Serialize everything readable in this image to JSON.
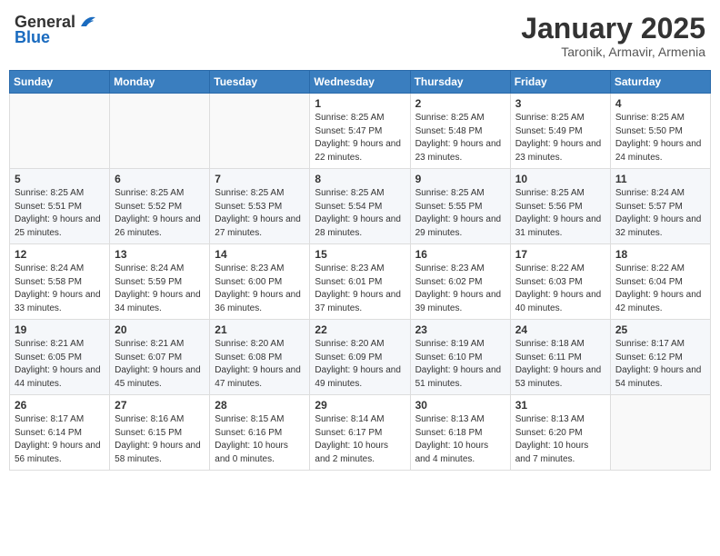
{
  "header": {
    "logo_line1": "General",
    "logo_line2": "Blue",
    "month_title": "January 2025",
    "location": "Taronik, Armavir, Armenia"
  },
  "days_of_week": [
    "Sunday",
    "Monday",
    "Tuesday",
    "Wednesday",
    "Thursday",
    "Friday",
    "Saturday"
  ],
  "weeks": [
    [
      {
        "day": "",
        "sunrise": "",
        "sunset": "",
        "daylight": ""
      },
      {
        "day": "",
        "sunrise": "",
        "sunset": "",
        "daylight": ""
      },
      {
        "day": "",
        "sunrise": "",
        "sunset": "",
        "daylight": ""
      },
      {
        "day": "1",
        "sunrise": "Sunrise: 8:25 AM",
        "sunset": "Sunset: 5:47 PM",
        "daylight": "Daylight: 9 hours and 22 minutes."
      },
      {
        "day": "2",
        "sunrise": "Sunrise: 8:25 AM",
        "sunset": "Sunset: 5:48 PM",
        "daylight": "Daylight: 9 hours and 23 minutes."
      },
      {
        "day": "3",
        "sunrise": "Sunrise: 8:25 AM",
        "sunset": "Sunset: 5:49 PM",
        "daylight": "Daylight: 9 hours and 23 minutes."
      },
      {
        "day": "4",
        "sunrise": "Sunrise: 8:25 AM",
        "sunset": "Sunset: 5:50 PM",
        "daylight": "Daylight: 9 hours and 24 minutes."
      }
    ],
    [
      {
        "day": "5",
        "sunrise": "Sunrise: 8:25 AM",
        "sunset": "Sunset: 5:51 PM",
        "daylight": "Daylight: 9 hours and 25 minutes."
      },
      {
        "day": "6",
        "sunrise": "Sunrise: 8:25 AM",
        "sunset": "Sunset: 5:52 PM",
        "daylight": "Daylight: 9 hours and 26 minutes."
      },
      {
        "day": "7",
        "sunrise": "Sunrise: 8:25 AM",
        "sunset": "Sunset: 5:53 PM",
        "daylight": "Daylight: 9 hours and 27 minutes."
      },
      {
        "day": "8",
        "sunrise": "Sunrise: 8:25 AM",
        "sunset": "Sunset: 5:54 PM",
        "daylight": "Daylight: 9 hours and 28 minutes."
      },
      {
        "day": "9",
        "sunrise": "Sunrise: 8:25 AM",
        "sunset": "Sunset: 5:55 PM",
        "daylight": "Daylight: 9 hours and 29 minutes."
      },
      {
        "day": "10",
        "sunrise": "Sunrise: 8:25 AM",
        "sunset": "Sunset: 5:56 PM",
        "daylight": "Daylight: 9 hours and 31 minutes."
      },
      {
        "day": "11",
        "sunrise": "Sunrise: 8:24 AM",
        "sunset": "Sunset: 5:57 PM",
        "daylight": "Daylight: 9 hours and 32 minutes."
      }
    ],
    [
      {
        "day": "12",
        "sunrise": "Sunrise: 8:24 AM",
        "sunset": "Sunset: 5:58 PM",
        "daylight": "Daylight: 9 hours and 33 minutes."
      },
      {
        "day": "13",
        "sunrise": "Sunrise: 8:24 AM",
        "sunset": "Sunset: 5:59 PM",
        "daylight": "Daylight: 9 hours and 34 minutes."
      },
      {
        "day": "14",
        "sunrise": "Sunrise: 8:23 AM",
        "sunset": "Sunset: 6:00 PM",
        "daylight": "Daylight: 9 hours and 36 minutes."
      },
      {
        "day": "15",
        "sunrise": "Sunrise: 8:23 AM",
        "sunset": "Sunset: 6:01 PM",
        "daylight": "Daylight: 9 hours and 37 minutes."
      },
      {
        "day": "16",
        "sunrise": "Sunrise: 8:23 AM",
        "sunset": "Sunset: 6:02 PM",
        "daylight": "Daylight: 9 hours and 39 minutes."
      },
      {
        "day": "17",
        "sunrise": "Sunrise: 8:22 AM",
        "sunset": "Sunset: 6:03 PM",
        "daylight": "Daylight: 9 hours and 40 minutes."
      },
      {
        "day": "18",
        "sunrise": "Sunrise: 8:22 AM",
        "sunset": "Sunset: 6:04 PM",
        "daylight": "Daylight: 9 hours and 42 minutes."
      }
    ],
    [
      {
        "day": "19",
        "sunrise": "Sunrise: 8:21 AM",
        "sunset": "Sunset: 6:05 PM",
        "daylight": "Daylight: 9 hours and 44 minutes."
      },
      {
        "day": "20",
        "sunrise": "Sunrise: 8:21 AM",
        "sunset": "Sunset: 6:07 PM",
        "daylight": "Daylight: 9 hours and 45 minutes."
      },
      {
        "day": "21",
        "sunrise": "Sunrise: 8:20 AM",
        "sunset": "Sunset: 6:08 PM",
        "daylight": "Daylight: 9 hours and 47 minutes."
      },
      {
        "day": "22",
        "sunrise": "Sunrise: 8:20 AM",
        "sunset": "Sunset: 6:09 PM",
        "daylight": "Daylight: 9 hours and 49 minutes."
      },
      {
        "day": "23",
        "sunrise": "Sunrise: 8:19 AM",
        "sunset": "Sunset: 6:10 PM",
        "daylight": "Daylight: 9 hours and 51 minutes."
      },
      {
        "day": "24",
        "sunrise": "Sunrise: 8:18 AM",
        "sunset": "Sunset: 6:11 PM",
        "daylight": "Daylight: 9 hours and 53 minutes."
      },
      {
        "day": "25",
        "sunrise": "Sunrise: 8:17 AM",
        "sunset": "Sunset: 6:12 PM",
        "daylight": "Daylight: 9 hours and 54 minutes."
      }
    ],
    [
      {
        "day": "26",
        "sunrise": "Sunrise: 8:17 AM",
        "sunset": "Sunset: 6:14 PM",
        "daylight": "Daylight: 9 hours and 56 minutes."
      },
      {
        "day": "27",
        "sunrise": "Sunrise: 8:16 AM",
        "sunset": "Sunset: 6:15 PM",
        "daylight": "Daylight: 9 hours and 58 minutes."
      },
      {
        "day": "28",
        "sunrise": "Sunrise: 8:15 AM",
        "sunset": "Sunset: 6:16 PM",
        "daylight": "Daylight: 10 hours and 0 minutes."
      },
      {
        "day": "29",
        "sunrise": "Sunrise: 8:14 AM",
        "sunset": "Sunset: 6:17 PM",
        "daylight": "Daylight: 10 hours and 2 minutes."
      },
      {
        "day": "30",
        "sunrise": "Sunrise: 8:13 AM",
        "sunset": "Sunset: 6:18 PM",
        "daylight": "Daylight: 10 hours and 4 minutes."
      },
      {
        "day": "31",
        "sunrise": "Sunrise: 8:13 AM",
        "sunset": "Sunset: 6:20 PM",
        "daylight": "Daylight: 10 hours and 7 minutes."
      },
      {
        "day": "",
        "sunrise": "",
        "sunset": "",
        "daylight": ""
      }
    ]
  ]
}
